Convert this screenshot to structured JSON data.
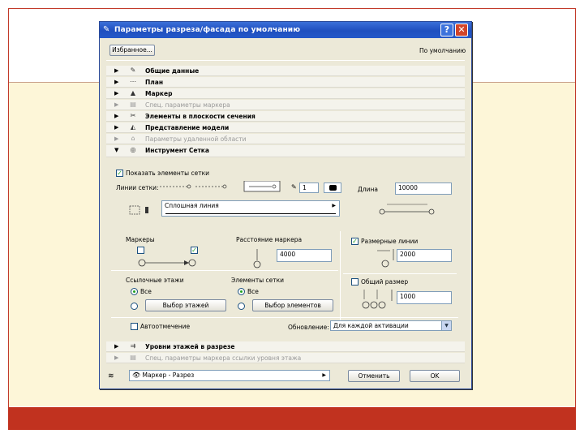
{
  "dialog": {
    "title": "Параметры разреза/фасада по умолчанию",
    "help_label": "?",
    "close_label": "✕",
    "favorites_label": "Избранное...",
    "default_label": "По умолчанию"
  },
  "sections_top": [
    {
      "label": "Общие данные",
      "arrow": "▶",
      "icon": "✎",
      "dim": false
    },
    {
      "label": "План",
      "arrow": "▶",
      "icon": "⋯",
      "dim": false
    },
    {
      "label": "Маркер",
      "arrow": "▶",
      "icon": "▲",
      "dim": false
    },
    {
      "label": "Спец. параметры маркера",
      "arrow": "▶",
      "icon": "▤",
      "dim": true
    },
    {
      "label": "Элементы в плоскости сечения",
      "arrow": "▶",
      "icon": "✂",
      "dim": false
    },
    {
      "label": "Представление модели",
      "arrow": "▶",
      "icon": "◭",
      "dim": false
    },
    {
      "label": "Параметры удаленной области",
      "arrow": "▶",
      "icon": "⌂",
      "dim": true
    },
    {
      "label": "Инструмент Сетка",
      "arrow": "▼",
      "icon": "◎",
      "dim": false
    }
  ],
  "grid_tool": {
    "show_grid_label": "Показать элементы сетки",
    "show_grid_checked": true,
    "grid_lines_label": "Линии сетки:",
    "pen_value": "1",
    "length_label": "Длина",
    "length_value": "10000",
    "line_type": "Сплошная линия",
    "markers_label": "Маркеры",
    "marker_distance_label": "Расстояние маркера",
    "marker_distance_value": "4000",
    "spacing_label": "Размерные линии",
    "spacing_checked": true,
    "spacing_value": "2000",
    "total_label": "Общий размер",
    "total_checked": false,
    "total_value": "1000",
    "stories_label": "Ссылочные этажи",
    "stories_all": "Все",
    "stories_button": "Выбор этажей",
    "elements_label": "Элементы сетки",
    "elements_all": "Все",
    "elements_button": "Выбор элементов",
    "auto_rebuild_label": "Автоотмечение",
    "auto_rebuild_checked": false,
    "update_label": "Обновление:",
    "update_value": "Для каждой активации"
  },
  "sections_bottom": [
    {
      "label": "Уровни этажей в разрезе",
      "arrow": "▶",
      "icon": "⇉",
      "dim": false
    },
    {
      "label": "Спец. параметры маркера ссылки уровня этажа",
      "arrow": "▶",
      "icon": "▤",
      "dim": true
    }
  ],
  "footer": {
    "layer_value": "Маркер - Разрез",
    "cancel_label": "Отменить",
    "ok_label": "OK"
  },
  "colors": {
    "titlebar": "#1f4fbf",
    "slide_accent": "#c1321f",
    "dialog_bg": "#ece9d8"
  }
}
